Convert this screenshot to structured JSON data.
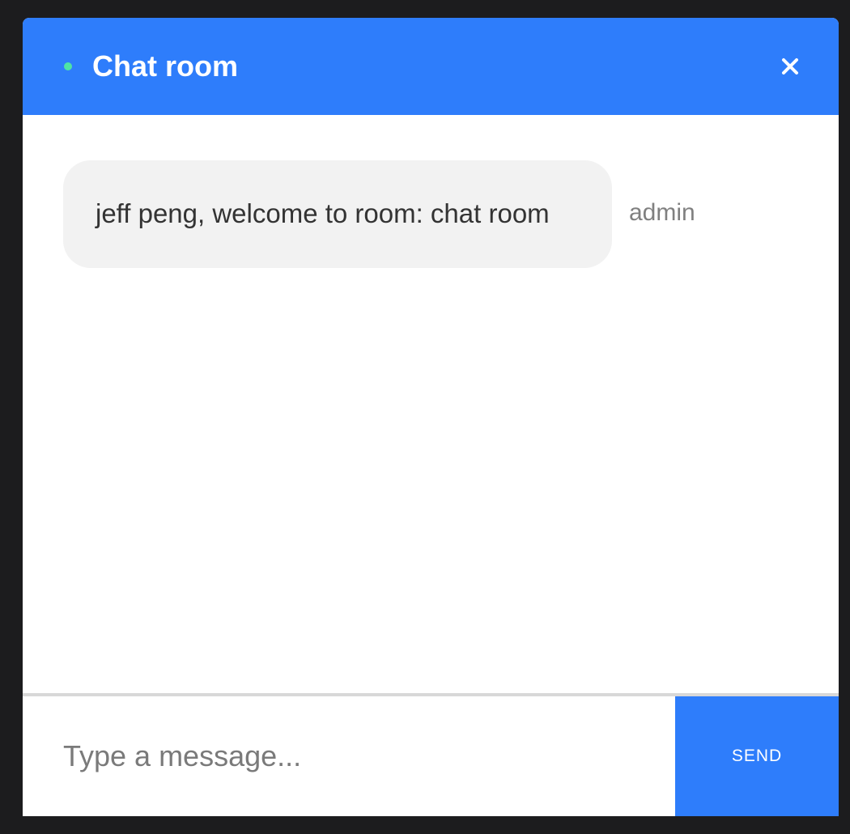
{
  "header": {
    "title": "Chat room",
    "status_icon": "online-status-dot",
    "close_icon": "close-icon"
  },
  "messages": [
    {
      "text": "jeff peng, welcome to room: chat room",
      "sender": "admin"
    }
  ],
  "composer": {
    "placeholder": "Type a message...",
    "value": "",
    "send_label": "SEND"
  },
  "colors": {
    "accent": "#2e7dfb",
    "status_online": "#4fe3a5",
    "bubble_background": "#f2f2f2",
    "page_background": "#1c1c1e"
  }
}
